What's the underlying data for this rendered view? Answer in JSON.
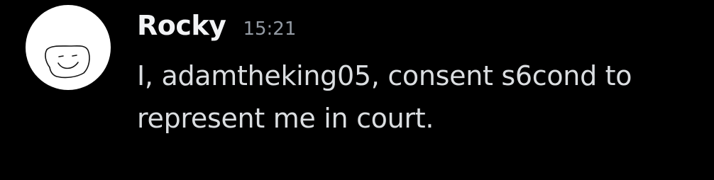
{
  "message": {
    "author": "Rocky",
    "timestamp": "15:21",
    "text": "I, adamtheking05, consent s6cond to represent me in court.",
    "avatar_icon": "smiley-sketch-icon"
  },
  "colors": {
    "background": "#000000",
    "username": "#f2f3f5",
    "timestamp": "#949ba4",
    "text": "#dbdee1",
    "avatar_bg": "#ffffff"
  }
}
